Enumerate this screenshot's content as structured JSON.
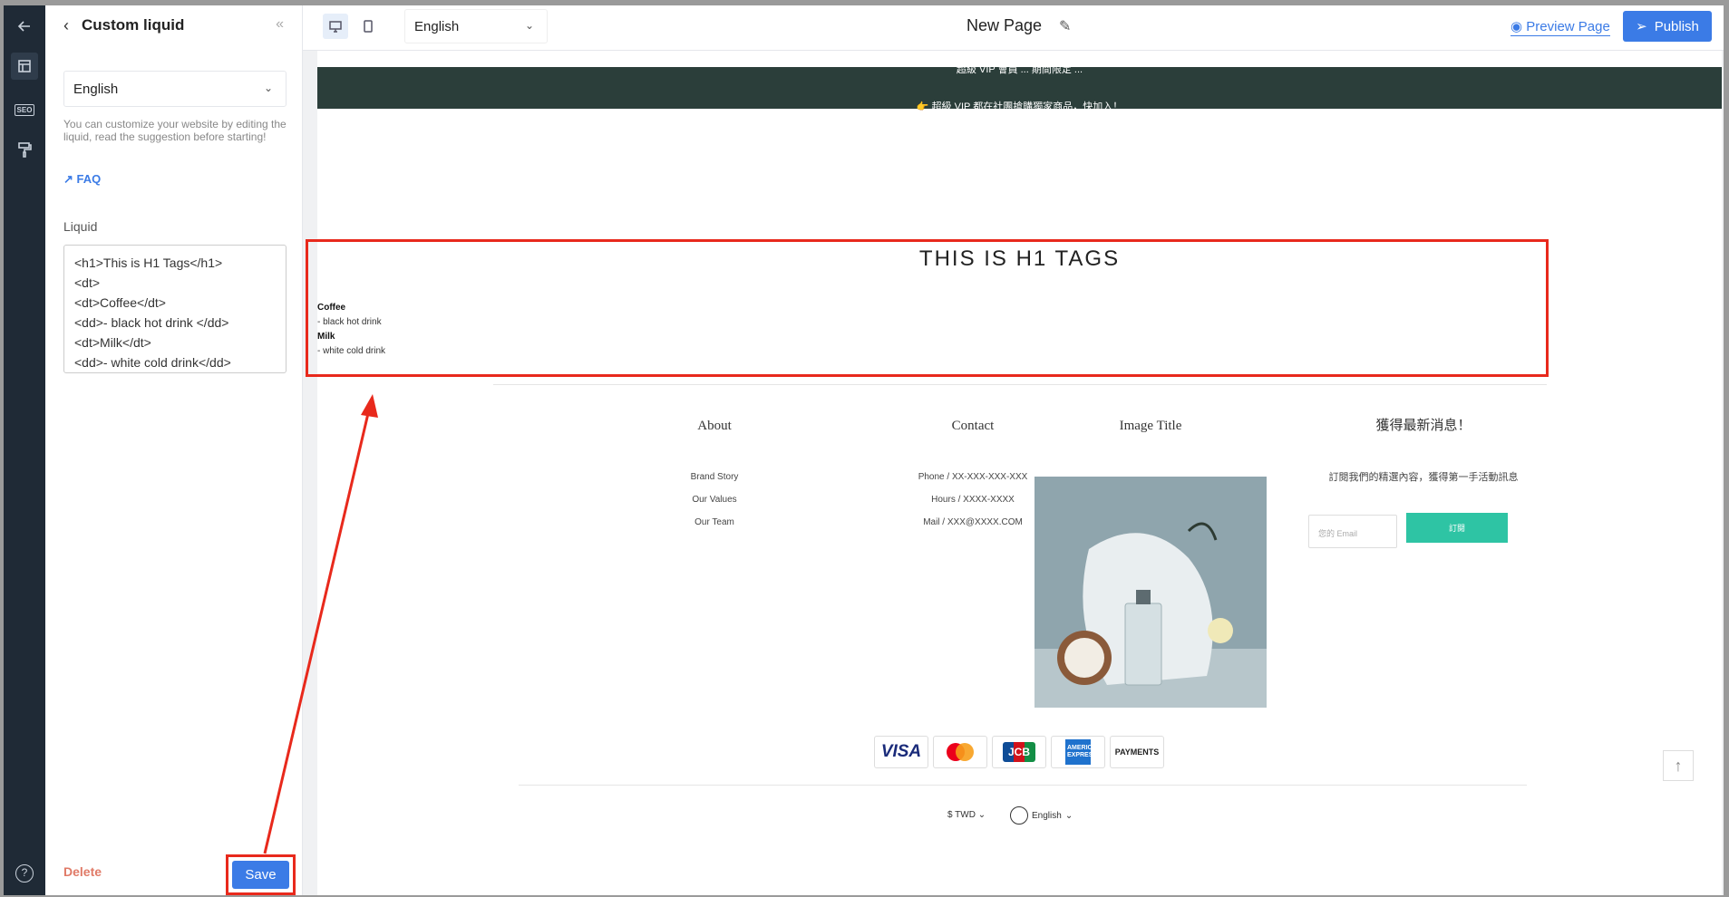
{
  "sidebar_panel": {
    "title": "Custom liquid",
    "language": "English",
    "hint": "You can customize your website by editing the liquid, read the suggestion before starting!",
    "faq_label": "FAQ",
    "liquid_label": "Liquid",
    "liquid_lines": [
      "<h1>This is H1 Tags</h1>",
      "<dt>",
      "<dt>Coffee</dt>",
      "<dd>- black hot drink </dd>",
      "<dt>Milk</dt>",
      "<dd>- white cold drink</dd>"
    ],
    "delete_label": "Delete",
    "save_label": "Save"
  },
  "toolbar": {
    "language": "English",
    "page_title": "New Page",
    "preview_label": "Preview Page",
    "publish_label": "Publish"
  },
  "preview": {
    "announcement_1": "超級 VIP 會員 ... 期間限定 ...",
    "announcement_2": "👉 超級 VIP 都在社團搶購獨家商品，快加入！",
    "h1": "THIS IS H1 TAGS",
    "dl": [
      {
        "dt": "Coffee",
        "dd": "- black hot drink"
      },
      {
        "dt": "Milk",
        "dd": "- white cold drink"
      }
    ],
    "about": {
      "head": "About",
      "links": [
        "Brand Story",
        "Our Values",
        "Our Team"
      ]
    },
    "contact": {
      "head": "Contact",
      "links": [
        "Phone / XX-XXX-XXX-XXX",
        "Hours / XXXX-XXXX",
        "Mail / XXX@XXXX.COM"
      ]
    },
    "image_title": "Image Title",
    "newsletter": {
      "head": "獲得最新消息！",
      "sub": "訂閱我們的精選內容，獲得第一手活動訊息",
      "email_placeholder": "您的 Email",
      "button": "訂閱"
    },
    "payments": [
      "VISA",
      "mastercard",
      "JCB",
      "AMERICAN EXPRESS",
      "PAYMENTS"
    ],
    "currency": "$ TWD",
    "language": "English"
  },
  "colors": {
    "accent": "#3b7be6",
    "annotation": "#e8291c",
    "announcement_bg": "#2b3e3a",
    "subscribe_bg": "#2ec4a4"
  }
}
